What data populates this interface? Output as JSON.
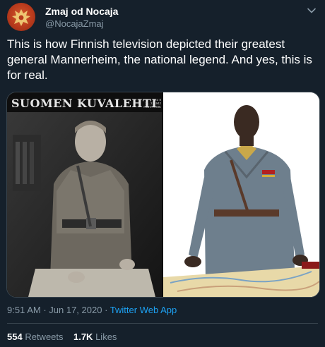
{
  "author": {
    "display_name": "Zmaj od Nocaja",
    "handle": "@NocajaZmaj",
    "avatar_icon": "double-headed-eagle-icon"
  },
  "menu_icon": "chevron-down-icon",
  "tweet": {
    "text": "This is how Finnish television depicted their greatest general Mannerheim, the national legend. And yes, this is for real."
  },
  "media": {
    "left_image": {
      "magazine_title": "SUOMEN KUVALEHTI",
      "magazine_meta": [
        "N:o 8",
        "21. 2. 1942",
        "HINTA 4 MK"
      ]
    },
    "right_image": {}
  },
  "meta": {
    "time": "9:51 AM",
    "separator": " · ",
    "date": "Jun 17, 2020",
    "app": "Twitter Web App"
  },
  "stats": {
    "retweets_count": "554",
    "retweets_label": "Retweets",
    "likes_count": "1.7K",
    "likes_label": "Likes"
  },
  "colors": {
    "background": "#15202b",
    "secondary_text": "#8899a6",
    "link": "#1da1f2",
    "divider": "#38444d"
  }
}
